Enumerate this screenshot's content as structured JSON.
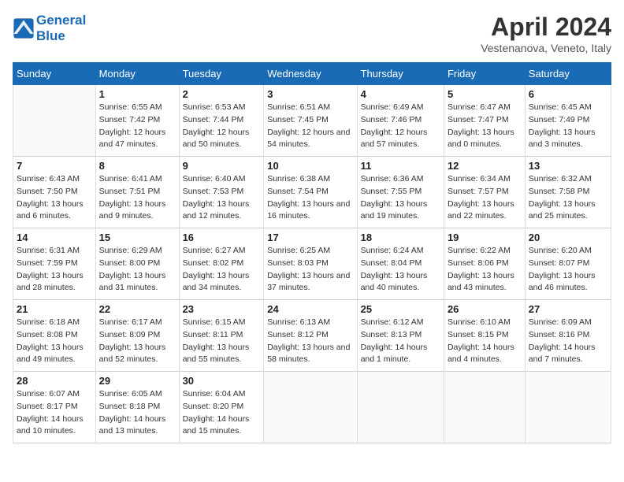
{
  "header": {
    "logo_line1": "General",
    "logo_line2": "Blue",
    "title": "April 2024",
    "location": "Vestenanova, Veneto, Italy"
  },
  "weekdays": [
    "Sunday",
    "Monday",
    "Tuesday",
    "Wednesday",
    "Thursday",
    "Friday",
    "Saturday"
  ],
  "weeks": [
    [
      {
        "day": "",
        "sunrise": "",
        "sunset": "",
        "daylight": ""
      },
      {
        "day": "1",
        "sunrise": "Sunrise: 6:55 AM",
        "sunset": "Sunset: 7:42 PM",
        "daylight": "Daylight: 12 hours and 47 minutes."
      },
      {
        "day": "2",
        "sunrise": "Sunrise: 6:53 AM",
        "sunset": "Sunset: 7:44 PM",
        "daylight": "Daylight: 12 hours and 50 minutes."
      },
      {
        "day": "3",
        "sunrise": "Sunrise: 6:51 AM",
        "sunset": "Sunset: 7:45 PM",
        "daylight": "Daylight: 12 hours and 54 minutes."
      },
      {
        "day": "4",
        "sunrise": "Sunrise: 6:49 AM",
        "sunset": "Sunset: 7:46 PM",
        "daylight": "Daylight: 12 hours and 57 minutes."
      },
      {
        "day": "5",
        "sunrise": "Sunrise: 6:47 AM",
        "sunset": "Sunset: 7:47 PM",
        "daylight": "Daylight: 13 hours and 0 minutes."
      },
      {
        "day": "6",
        "sunrise": "Sunrise: 6:45 AM",
        "sunset": "Sunset: 7:49 PM",
        "daylight": "Daylight: 13 hours and 3 minutes."
      }
    ],
    [
      {
        "day": "7",
        "sunrise": "Sunrise: 6:43 AM",
        "sunset": "Sunset: 7:50 PM",
        "daylight": "Daylight: 13 hours and 6 minutes."
      },
      {
        "day": "8",
        "sunrise": "Sunrise: 6:41 AM",
        "sunset": "Sunset: 7:51 PM",
        "daylight": "Daylight: 13 hours and 9 minutes."
      },
      {
        "day": "9",
        "sunrise": "Sunrise: 6:40 AM",
        "sunset": "Sunset: 7:53 PM",
        "daylight": "Daylight: 13 hours and 12 minutes."
      },
      {
        "day": "10",
        "sunrise": "Sunrise: 6:38 AM",
        "sunset": "Sunset: 7:54 PM",
        "daylight": "Daylight: 13 hours and 16 minutes."
      },
      {
        "day": "11",
        "sunrise": "Sunrise: 6:36 AM",
        "sunset": "Sunset: 7:55 PM",
        "daylight": "Daylight: 13 hours and 19 minutes."
      },
      {
        "day": "12",
        "sunrise": "Sunrise: 6:34 AM",
        "sunset": "Sunset: 7:57 PM",
        "daylight": "Daylight: 13 hours and 22 minutes."
      },
      {
        "day": "13",
        "sunrise": "Sunrise: 6:32 AM",
        "sunset": "Sunset: 7:58 PM",
        "daylight": "Daylight: 13 hours and 25 minutes."
      }
    ],
    [
      {
        "day": "14",
        "sunrise": "Sunrise: 6:31 AM",
        "sunset": "Sunset: 7:59 PM",
        "daylight": "Daylight: 13 hours and 28 minutes."
      },
      {
        "day": "15",
        "sunrise": "Sunrise: 6:29 AM",
        "sunset": "Sunset: 8:00 PM",
        "daylight": "Daylight: 13 hours and 31 minutes."
      },
      {
        "day": "16",
        "sunrise": "Sunrise: 6:27 AM",
        "sunset": "Sunset: 8:02 PM",
        "daylight": "Daylight: 13 hours and 34 minutes."
      },
      {
        "day": "17",
        "sunrise": "Sunrise: 6:25 AM",
        "sunset": "Sunset: 8:03 PM",
        "daylight": "Daylight: 13 hours and 37 minutes."
      },
      {
        "day": "18",
        "sunrise": "Sunrise: 6:24 AM",
        "sunset": "Sunset: 8:04 PM",
        "daylight": "Daylight: 13 hours and 40 minutes."
      },
      {
        "day": "19",
        "sunrise": "Sunrise: 6:22 AM",
        "sunset": "Sunset: 8:06 PM",
        "daylight": "Daylight: 13 hours and 43 minutes."
      },
      {
        "day": "20",
        "sunrise": "Sunrise: 6:20 AM",
        "sunset": "Sunset: 8:07 PM",
        "daylight": "Daylight: 13 hours and 46 minutes."
      }
    ],
    [
      {
        "day": "21",
        "sunrise": "Sunrise: 6:18 AM",
        "sunset": "Sunset: 8:08 PM",
        "daylight": "Daylight: 13 hours and 49 minutes."
      },
      {
        "day": "22",
        "sunrise": "Sunrise: 6:17 AM",
        "sunset": "Sunset: 8:09 PM",
        "daylight": "Daylight: 13 hours and 52 minutes."
      },
      {
        "day": "23",
        "sunrise": "Sunrise: 6:15 AM",
        "sunset": "Sunset: 8:11 PM",
        "daylight": "Daylight: 13 hours and 55 minutes."
      },
      {
        "day": "24",
        "sunrise": "Sunrise: 6:13 AM",
        "sunset": "Sunset: 8:12 PM",
        "daylight": "Daylight: 13 hours and 58 minutes."
      },
      {
        "day": "25",
        "sunrise": "Sunrise: 6:12 AM",
        "sunset": "Sunset: 8:13 PM",
        "daylight": "Daylight: 14 hours and 1 minute."
      },
      {
        "day": "26",
        "sunrise": "Sunrise: 6:10 AM",
        "sunset": "Sunset: 8:15 PM",
        "daylight": "Daylight: 14 hours and 4 minutes."
      },
      {
        "day": "27",
        "sunrise": "Sunrise: 6:09 AM",
        "sunset": "Sunset: 8:16 PM",
        "daylight": "Daylight: 14 hours and 7 minutes."
      }
    ],
    [
      {
        "day": "28",
        "sunrise": "Sunrise: 6:07 AM",
        "sunset": "Sunset: 8:17 PM",
        "daylight": "Daylight: 14 hours and 10 minutes."
      },
      {
        "day": "29",
        "sunrise": "Sunrise: 6:05 AM",
        "sunset": "Sunset: 8:18 PM",
        "daylight": "Daylight: 14 hours and 13 minutes."
      },
      {
        "day": "30",
        "sunrise": "Sunrise: 6:04 AM",
        "sunset": "Sunset: 8:20 PM",
        "daylight": "Daylight: 14 hours and 15 minutes."
      },
      {
        "day": "",
        "sunrise": "",
        "sunset": "",
        "daylight": ""
      },
      {
        "day": "",
        "sunrise": "",
        "sunset": "",
        "daylight": ""
      },
      {
        "day": "",
        "sunrise": "",
        "sunset": "",
        "daylight": ""
      },
      {
        "day": "",
        "sunrise": "",
        "sunset": "",
        "daylight": ""
      }
    ]
  ]
}
